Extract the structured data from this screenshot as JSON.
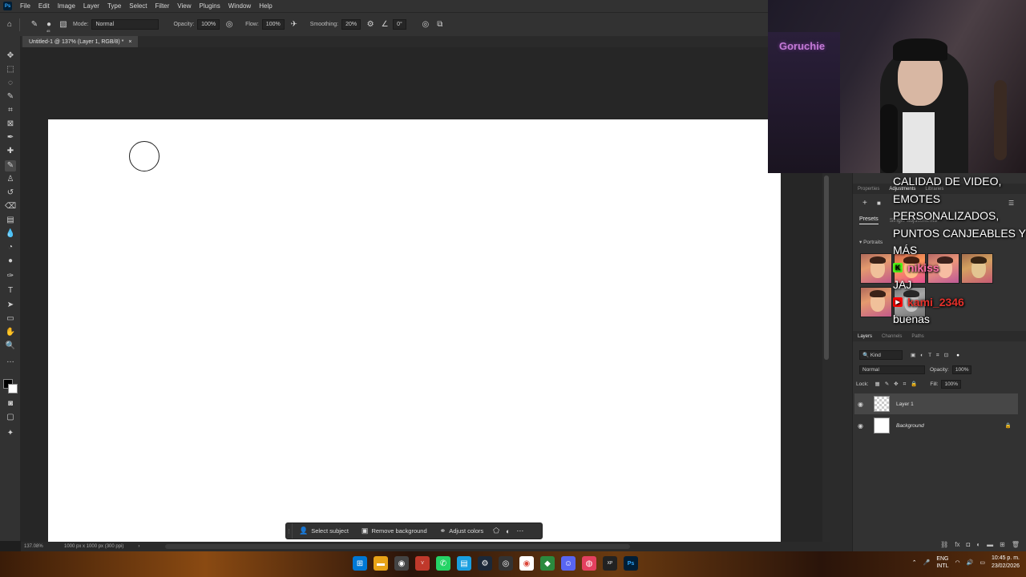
{
  "menubar": {
    "items": [
      "File",
      "Edit",
      "Image",
      "Layer",
      "Type",
      "Select",
      "Filter",
      "View",
      "Plugins",
      "Window",
      "Help"
    ]
  },
  "options": {
    "brush_size": "45",
    "mode_label": "Mode:",
    "mode_value": "Normal",
    "opacity_label": "Opacity:",
    "opacity_value": "100%",
    "flow_label": "Flow:",
    "flow_value": "100%",
    "smoothing_label": "Smoothing:",
    "smoothing_value": "20%",
    "angle_value": "0°"
  },
  "document": {
    "tab_title": "Untitled-1 @ 137% (Layer 1, RGB/8) *",
    "zoom": "137.08%",
    "doc_info": "1000 px x 1000 px (300 ppi)"
  },
  "context_bar": {
    "select_subject": "Select subject",
    "remove_background": "Remove background",
    "adjust_colors": "Adjust colors"
  },
  "properties_panel": {
    "tabs": [
      "Properties",
      "Adjustments",
      "Libraries"
    ],
    "subtabs": [
      "Presets",
      "Single adjustments"
    ],
    "group_header": "Portraits"
  },
  "layers_panel": {
    "tabs": [
      "Layers",
      "Channels",
      "Paths"
    ],
    "kind_label": "Kind",
    "blend_mode": "Normal",
    "opacity_label": "Opacity:",
    "opacity_value": "100%",
    "lock_label": "Lock:",
    "fill_label": "Fill:",
    "fill_value": "100%",
    "layers": [
      {
        "name": "Layer 1",
        "selected": true
      },
      {
        "name": "Background",
        "selected": false
      }
    ]
  },
  "webcam": {
    "sign_text": "Goruchie"
  },
  "chat": {
    "message_1": "CALIDAD DE VIDEO, EMOTES PERSONALIZADOS, PUNTOS CANJEABLES Y MÁS",
    "user_1": "nikiss",
    "message_2": "JAJ",
    "user_2": "kami_2346",
    "message_3": "buenas"
  },
  "taskbar": {
    "lang_1": "ENG",
    "lang_2": "INTL",
    "time": "10:45 p. m.",
    "date": "23/02/2026"
  },
  "colors": {
    "chat_user_1": "#ff6fa8",
    "chat_user_2": "#e3302a",
    "ps_accent": "#31a8ff"
  }
}
